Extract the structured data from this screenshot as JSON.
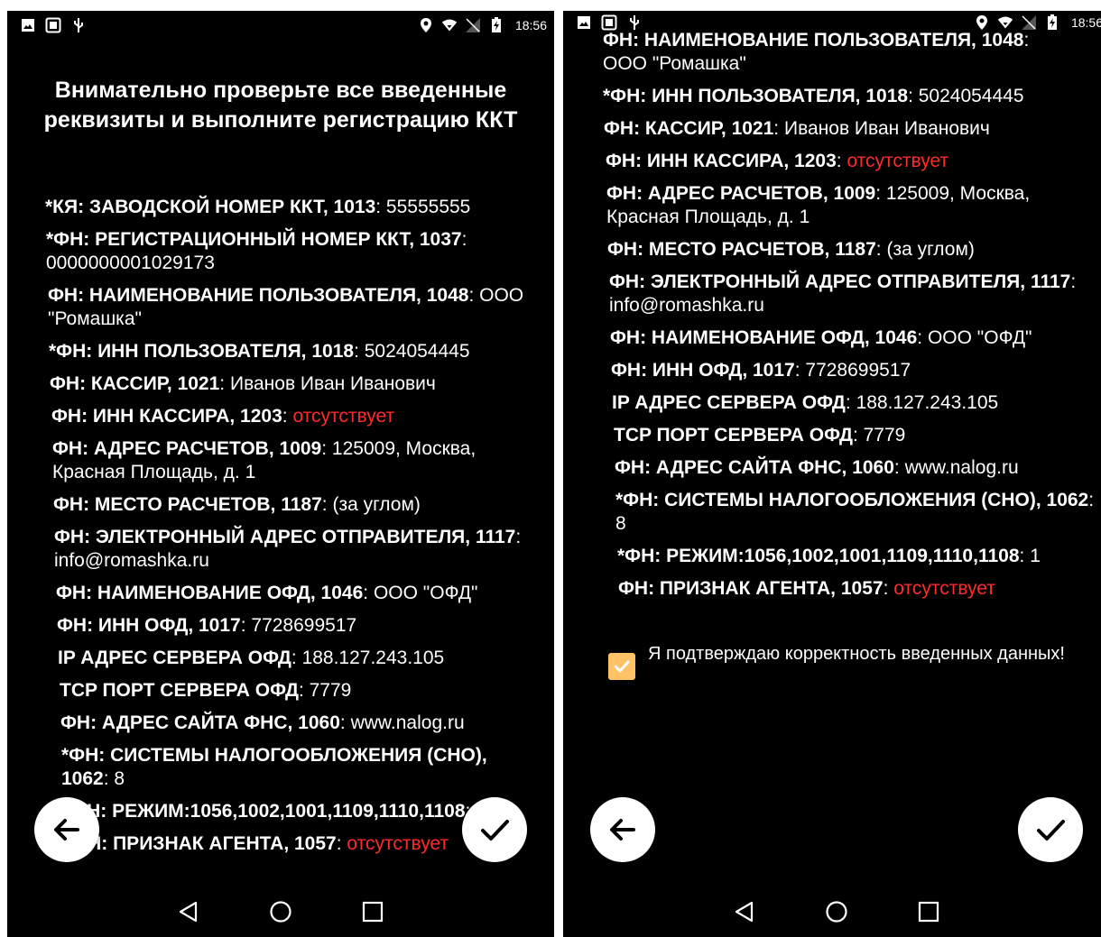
{
  "status_bar": {
    "time": "18:56"
  },
  "left_screen": {
    "title": "Внимательно проверьте все введенные реквизиты и выполните регистрацию ККТ",
    "items": [
      {
        "label": "*КЯ: ЗАВОДСКОЙ НОМЕР ККТ, 1013",
        "value": "55555555",
        "color": "white"
      },
      {
        "label": "*ФН: РЕГИСТРАЦИОННЫЙ НОМЕР ККТ, 1037",
        "value": "0000000001029173",
        "color": "white"
      },
      {
        "label": "ФН: НАИМЕНОВАНИЕ ПОЛЬЗОВАТЕЛЯ, 1048",
        "value": "ООО \"Ромашка\"",
        "color": "white"
      },
      {
        "label": "*ФН: ИНН ПОЛЬЗОВАТЕЛЯ, 1018",
        "value": "5024054445",
        "color": "white"
      },
      {
        "label": "ФН: КАССИР, 1021",
        "value": "Иванов Иван Иванович",
        "color": "white"
      },
      {
        "label": "ФН: ИНН КАССИРА, 1203",
        "value": "отсутствует",
        "color": "red"
      },
      {
        "label": "ФН: АДРЕС РАСЧЕТОВ, 1009",
        "value": "125009, Москва, Красная Площадь, д. 1",
        "color": "white"
      },
      {
        "label": "ФН: МЕСТО РАСЧЕТОВ, 1187",
        "value": "(за углом)",
        "color": "white"
      },
      {
        "label": "ФН: ЭЛЕКТРОННЫЙ АДРЕС ОТПРАВИТЕЛЯ, 1117",
        "value": "info@romashka.ru",
        "color": "white"
      },
      {
        "label": "ФН: НАИМЕНОВАНИЕ ОФД, 1046",
        "value": "ООО \"ОФД\"",
        "color": "white"
      },
      {
        "label": "ФН: ИНН ОФД, 1017",
        "value": "7728699517",
        "color": "white"
      },
      {
        "label": "IP АДРЕС СЕРВЕРА ОФД",
        "value": "188.127.243.105",
        "color": "white"
      },
      {
        "label": "TCP ПОРТ СЕРВЕРА ОФД",
        "value": "7779",
        "color": "white"
      },
      {
        "label": "ФН: АДРЕС САЙТА ФНС, 1060",
        "value": "www.nalog.ru",
        "color": "white"
      },
      {
        "label": "*ФН: СИСТЕМЫ НАЛОГООБЛОЖЕНИЯ (СНО), 1062",
        "value": "8",
        "color": "white"
      },
      {
        "label": "*ФН: РЕЖИМ:1056,1002,1001,1109,1110,1108",
        "value": "1",
        "color": "white"
      },
      {
        "label": "*ФН: ПРИЗНАК АГЕНТА, 1057",
        "value": "отсутствует",
        "color": "red"
      }
    ]
  },
  "right_screen": {
    "partial_top_label": "ФН: НАИМЕНОВАНИЕ ПОЛЬЗОВАТЕЛЯ, 1048",
    "partial_top_value": "ООО \"Ромашка\"",
    "items": [
      {
        "label": "*ФН: ИНН ПОЛЬЗОВАТЕЛЯ, 1018",
        "value": "5024054445",
        "color": "white"
      },
      {
        "label": "ФН: КАССИР, 1021",
        "value": "Иванов Иван Иванович",
        "color": "white"
      },
      {
        "label": "ФН: ИНН КАССИРА, 1203",
        "value": "отсутствует",
        "color": "red"
      },
      {
        "label": "ФН: АДРЕС РАСЧЕТОВ, 1009",
        "value": "125009, Москва, Красная Площадь, д. 1",
        "color": "white"
      },
      {
        "label": "ФН: МЕСТО РАСЧЕТОВ, 1187",
        "value": "(за углом)",
        "color": "white"
      },
      {
        "label": "ФН: ЭЛЕКТРОННЫЙ АДРЕС ОТПРАВИТЕЛЯ, 1117",
        "value": "info@romashka.ru",
        "color": "white"
      },
      {
        "label": "ФН: НАИМЕНОВАНИЕ ОФД, 1046",
        "value": "ООО \"ОФД\"",
        "color": "white"
      },
      {
        "label": "ФН: ИНН ОФД, 1017",
        "value": "7728699517",
        "color": "white"
      },
      {
        "label": "IP АДРЕС СЕРВЕРА ОФД",
        "value": "188.127.243.105",
        "color": "white"
      },
      {
        "label": "TCP ПОРТ СЕРВЕРА ОФД",
        "value": "7779",
        "color": "white"
      },
      {
        "label": "ФН: АДРЕС САЙТА ФНС, 1060",
        "value": "www.nalog.ru",
        "color": "white"
      },
      {
        "label": "*ФН: СИСТЕМЫ НАЛОГООБЛОЖЕНИЯ (СНО), 1062",
        "value": "8",
        "color": "white"
      },
      {
        "label": "*ФН: РЕЖИМ:1056,1002,1001,1109,1110,1108",
        "value": "1",
        "color": "white"
      },
      {
        "label": "ФН: ПРИЗНАК АГЕНТА, 1057",
        "value": "отсутствует",
        "color": "red"
      }
    ],
    "confirm_checkbox_label": "Я подтверждаю корректность введенных данных!",
    "confirm_checked": true
  },
  "colors": {
    "background": "#000000",
    "text": "#ffffff",
    "missing_value": "#ff2a2a",
    "checkbox": "#ffc266"
  },
  "icons": [
    "image-icon",
    "screenshot-icon",
    "usb-icon",
    "location-icon",
    "wifi-icon",
    "no-sim-icon",
    "battery-charging-icon",
    "back-arrow-icon",
    "check-icon",
    "nav-back-icon",
    "nav-home-icon",
    "nav-recents-icon"
  ]
}
